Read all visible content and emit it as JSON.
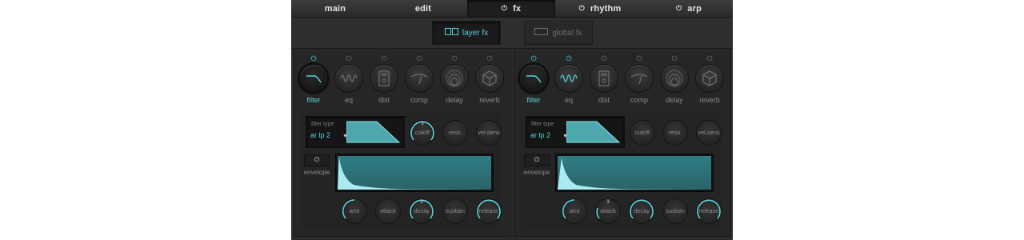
{
  "colors": {
    "accent": "#5ad1de",
    "panel": "#262626",
    "dark": "#121212",
    "text_dim": "#8a8a8a"
  },
  "tabs": {
    "main": {
      "label": "main"
    },
    "edit": {
      "label": "edit"
    },
    "fx": {
      "label": "fx",
      "icon": "power-icon"
    },
    "rhythm": {
      "label": "rhythm",
      "icon": "power-icon"
    },
    "arp": {
      "label": "arp",
      "icon": "power-icon"
    }
  },
  "subtabs": {
    "layer_fx": {
      "label": "layer fx",
      "icon": "dual-layer-icon"
    },
    "global_fx": {
      "label": "global fx",
      "icon": "single-layer-icon"
    }
  },
  "panels": {
    "left": {
      "fx_units": [
        {
          "label": "filter",
          "icon": "filter-curve-icon"
        },
        {
          "label": "eq",
          "icon": "eq-wave-icon"
        },
        {
          "label": "dist",
          "icon": "distortion-pedal-icon"
        },
        {
          "label": "comp",
          "icon": "compressor-meter-icon"
        },
        {
          "label": "delay",
          "icon": "delay-rings-icon"
        },
        {
          "label": "reverb",
          "icon": "reverb-cube-icon"
        }
      ],
      "filter_type_label": "filter type",
      "filter_type_value": "ar lp 2",
      "filter_knobs": {
        "cutoff": {
          "label": "cutoff",
          "value_text": "3"
        },
        "reso": {
          "label": "reso.",
          "value_text": ""
        },
        "vel_sens": {
          "label": "vel.sens",
          "value_text": ""
        }
      },
      "envelope_label": "envelope",
      "env_knobs": {
        "amt": {
          "label": "amt",
          "value_text": ""
        },
        "attack": {
          "label": "attack",
          "value_text": ""
        },
        "decay": {
          "label": "decay",
          "value_text": "3"
        },
        "sustain": {
          "label": "sustain",
          "value_text": ""
        },
        "release": {
          "label": "release",
          "value_text": ""
        }
      }
    },
    "right": {
      "fx_units": [
        {
          "label": "filter",
          "icon": "filter-curve-icon"
        },
        {
          "label": "eq",
          "icon": "eq-wave-icon"
        },
        {
          "label": "dist",
          "icon": "distortion-pedal-icon"
        },
        {
          "label": "comp",
          "icon": "compressor-meter-icon"
        },
        {
          "label": "delay",
          "icon": "delay-rings-icon"
        },
        {
          "label": "reverb",
          "icon": "reverb-cube-icon"
        }
      ],
      "filter_type_label": "filter type",
      "filter_type_value": "ar lp 2",
      "filter_knobs": {
        "cutoff": {
          "label": "cutoff",
          "value_text": ""
        },
        "reso": {
          "label": "reso.",
          "value_text": ""
        },
        "vel_sens": {
          "label": "vel.sens",
          "value_text": ""
        }
      },
      "envelope_label": "envelope",
      "env_knobs": {
        "amt": {
          "label": "amt",
          "value_text": ""
        },
        "attack": {
          "label": "attack",
          "value_text": "3"
        },
        "decay": {
          "label": "decay",
          "value_text": ""
        },
        "sustain": {
          "label": "sustain",
          "value_text": ""
        },
        "release": {
          "label": "release",
          "value_text": ""
        }
      }
    }
  }
}
